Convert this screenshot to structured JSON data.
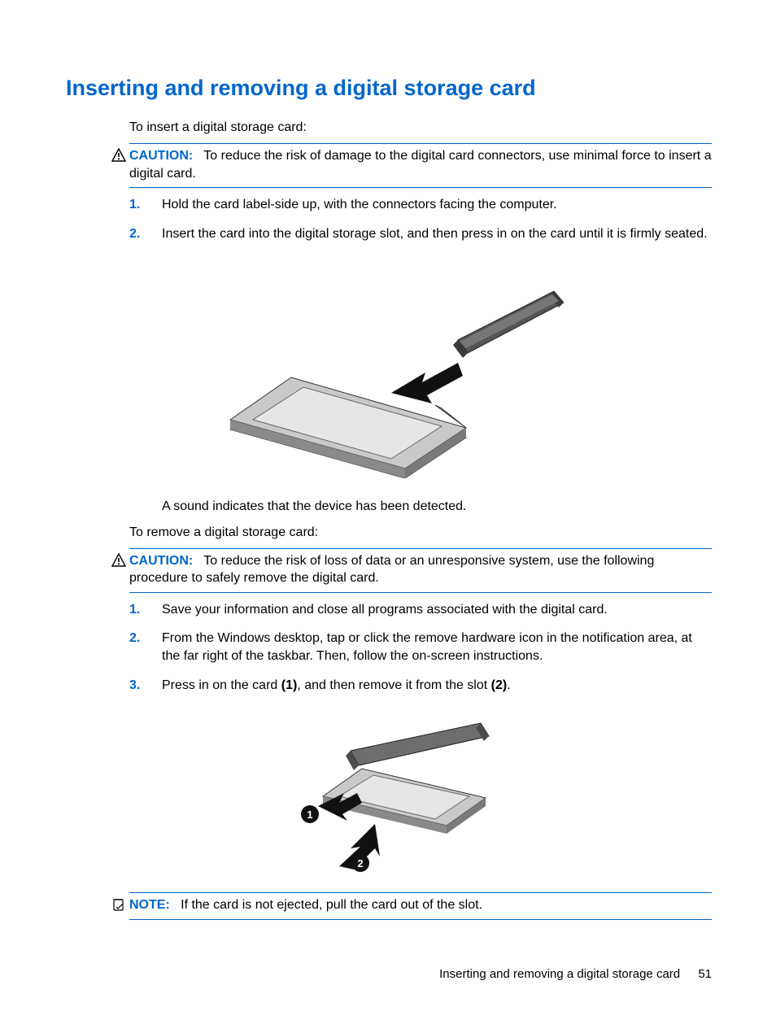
{
  "heading": "Inserting and removing a digital storage card",
  "intro_insert": "To insert a digital storage card:",
  "caution1": {
    "label": "CAUTION:",
    "text": "To reduce the risk of damage to the digital card connectors, use minimal force to insert a digital card."
  },
  "insert_steps": [
    {
      "num": "1.",
      "text": "Hold the card label-side up, with the connectors facing the computer."
    },
    {
      "num": "2.",
      "text": "Insert the card into the digital storage slot, and then press in on the card until it is firmly seated."
    }
  ],
  "detect_text": "A sound indicates that the device has been detected.",
  "intro_remove": "To remove a digital storage card:",
  "caution2": {
    "label": "CAUTION:",
    "text": "To reduce the risk of loss of data or an unresponsive system, use the following procedure to safely remove the digital card."
  },
  "remove_steps": [
    {
      "num": "1.",
      "text": "Save your information and close all programs associated with the digital card."
    },
    {
      "num": "2.",
      "text": "From the Windows desktop, tap or click the remove hardware icon in the notification area, at the far right of the taskbar. Then, follow the on-screen instructions."
    },
    {
      "num": "3.",
      "pre": "Press in on the card ",
      "b1": "(1)",
      "mid": ", and then remove it from the slot ",
      "b2": "(2)",
      "post": "."
    }
  ],
  "note": {
    "label": "NOTE:",
    "text": "If the card is not ejected, pull the card out of the slot."
  },
  "footer": {
    "title": "Inserting and removing a digital storage card",
    "page": "51"
  }
}
